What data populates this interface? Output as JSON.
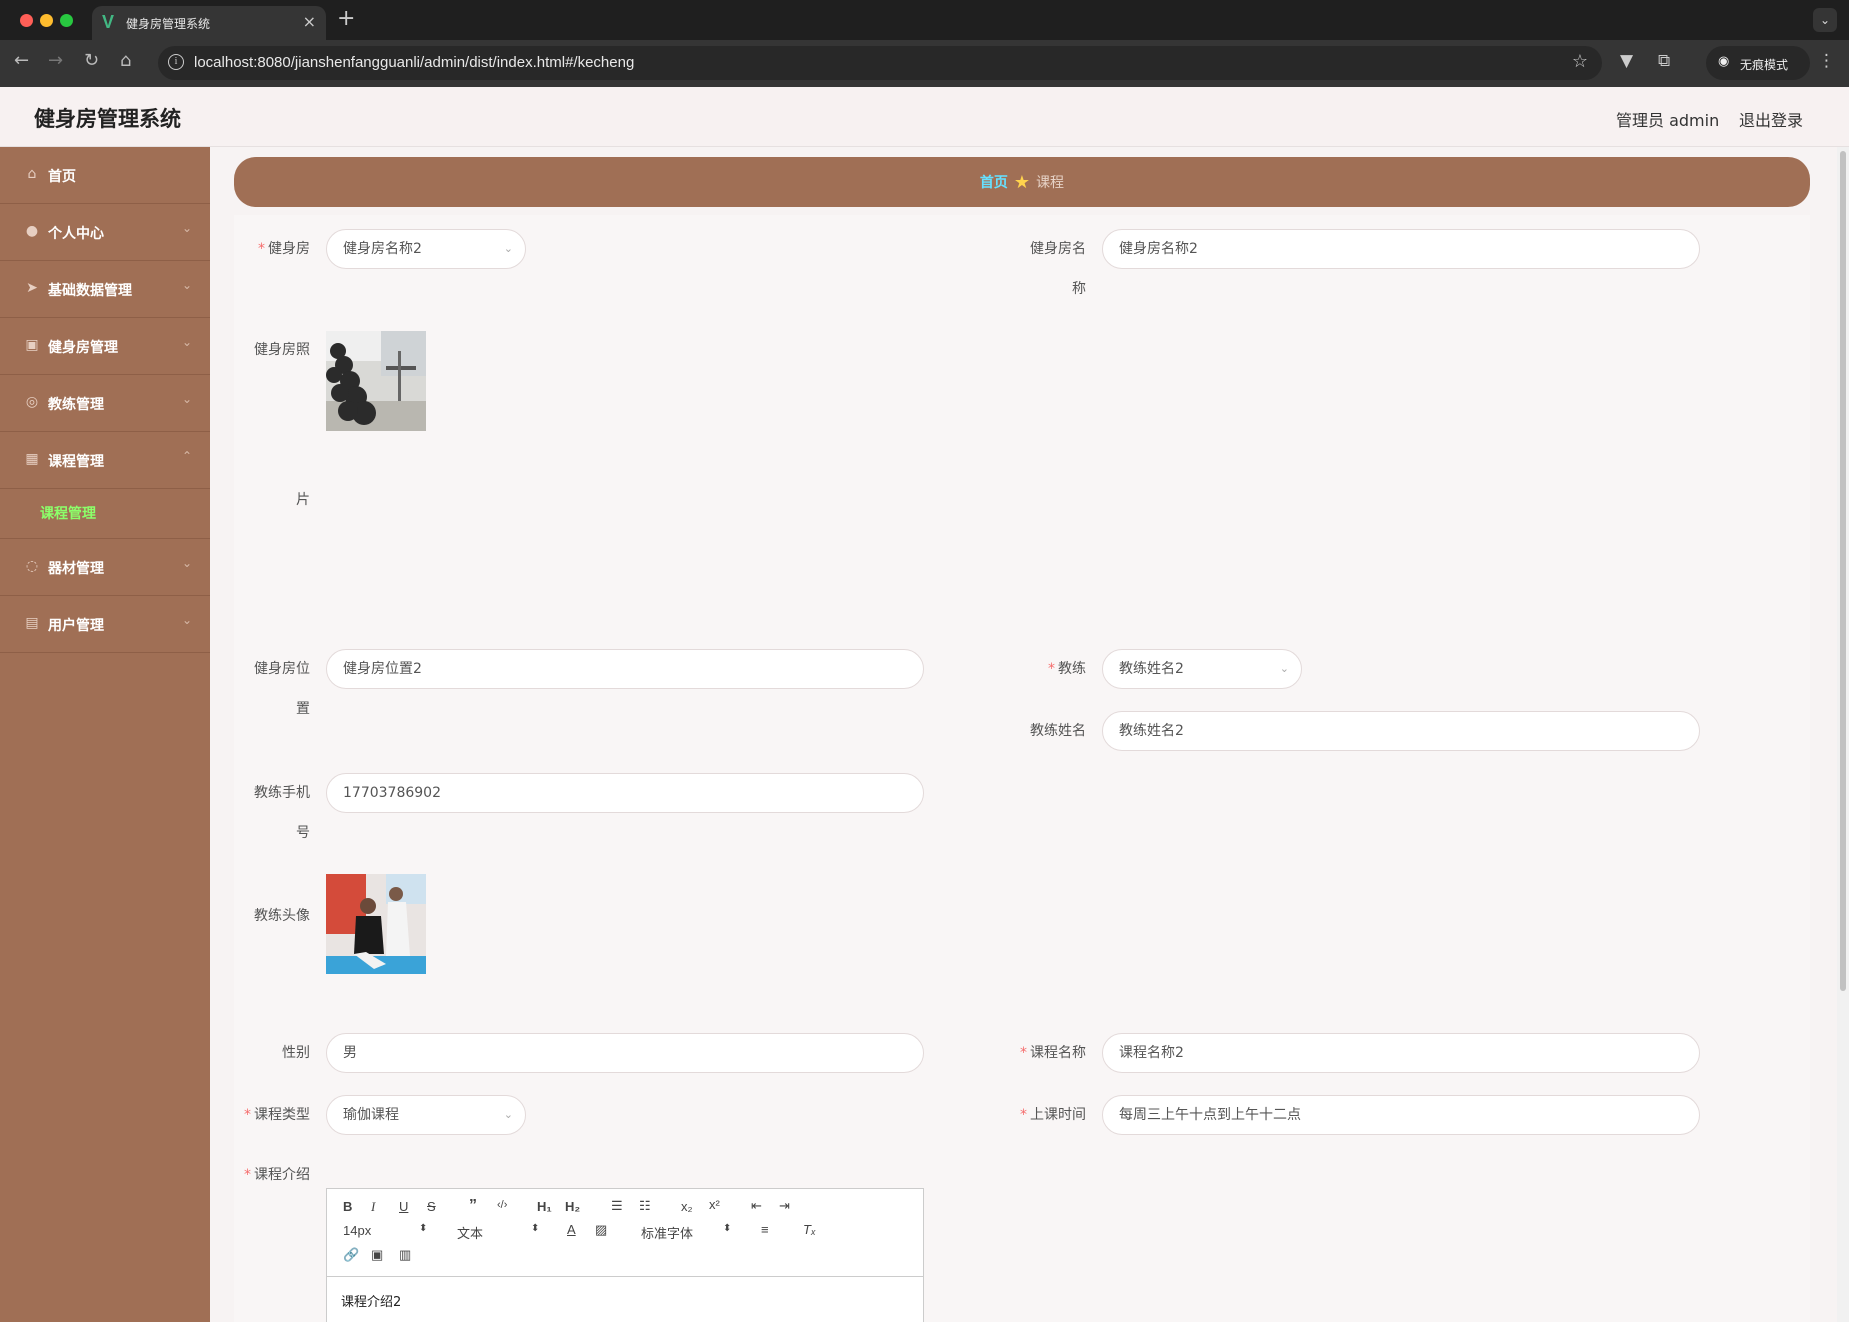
{
  "browser": {
    "tab_title": "健身房管理系统",
    "tab_favicon": "V",
    "url": "localhost:8080/jianshenfangguanli/admin/dist/index.html#/kecheng",
    "incognito_label": "无痕模式"
  },
  "header": {
    "title": "健身房管理系统",
    "user_label": "管理员 admin",
    "logout_label": "退出登录"
  },
  "sidebar": {
    "items": [
      {
        "label": "首页",
        "icon": "home-icon"
      },
      {
        "label": "个人中心",
        "icon": "user-icon"
      },
      {
        "label": "基础数据管理",
        "icon": "send-icon"
      },
      {
        "label": "健身房管理",
        "icon": "calendar-icon"
      },
      {
        "label": "教练管理",
        "icon": "compass-icon"
      },
      {
        "label": "课程管理",
        "icon": "grid-icon"
      },
      {
        "label": "器材管理",
        "icon": "timer-icon"
      },
      {
        "label": "用户管理",
        "icon": "clipboard-icon"
      }
    ],
    "sub_item": "课程管理"
  },
  "breadcrumb": {
    "home": "首页",
    "current": "课程"
  },
  "form": {
    "gym": {
      "label": "健身房",
      "value": "健身房名称2"
    },
    "gym_name": {
      "label_1": "健身房名",
      "label_2": "称",
      "value": "健身房名称2"
    },
    "gym_photo": {
      "label_1": "健身房照",
      "label_2": "片"
    },
    "gym_location": {
      "label_1": "健身房位",
      "label_2": "置",
      "value": "健身房位置2"
    },
    "coach": {
      "label": "教练",
      "value": "教练姓名2"
    },
    "coach_name": {
      "label": "教练姓名",
      "value": "教练姓名2"
    },
    "coach_phone": {
      "label_1": "教练手机",
      "label_2": "号",
      "value": "17703786902"
    },
    "coach_avatar": {
      "label": "教练头像"
    },
    "gender": {
      "label": "性别",
      "value": "男"
    },
    "course_name": {
      "label": "课程名称",
      "value": "课程名称2"
    },
    "course_type": {
      "label": "课程类型",
      "value": "瑜伽课程"
    },
    "class_time": {
      "label": "上课时间",
      "value": "每周三上午十点到上午十二点"
    },
    "course_intro": {
      "label": "课程介绍",
      "value": "课程介绍2"
    }
  },
  "editor": {
    "font_size": "14px",
    "text_style": "文本",
    "font_family": "标准字体"
  }
}
